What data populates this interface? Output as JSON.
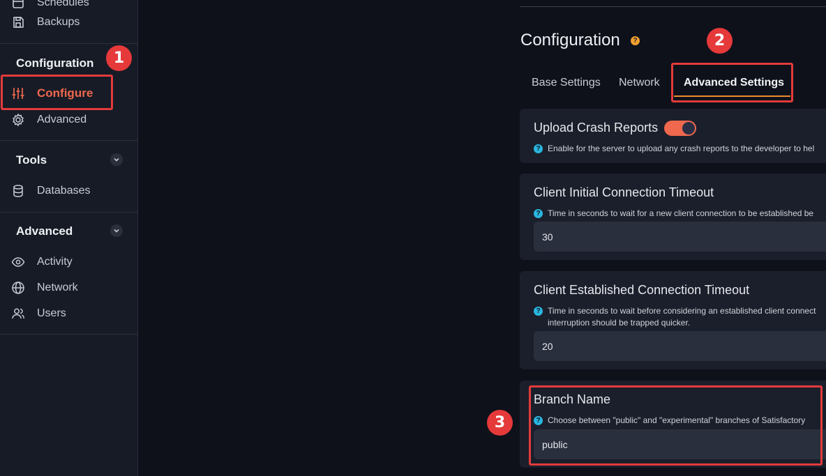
{
  "sidebar": {
    "top_partial_label": "Schedules",
    "backups_label": "Backups",
    "configuration_section": "Configuration",
    "configure_label": "Configure",
    "advanced_item_label": "Advanced",
    "tools_section": "Tools",
    "databases_label": "Databases",
    "advanced_section": "Advanced",
    "activity_label": "Activity",
    "network_label": "Network",
    "users_label": "Users"
  },
  "annotations": {
    "step1": "1",
    "step2": "2",
    "step3": "3"
  },
  "main": {
    "title": "Configuration",
    "help_glyph": "?",
    "tabs": [
      "Base Settings",
      "Network",
      "Advanced Settings"
    ],
    "cards": {
      "crash": {
        "title": "Upload Crash Reports",
        "help": "Enable for the server to upload any crash reports to the developer to hel",
        "enabled": true
      },
      "initial_timeout": {
        "title": "Client Initial Connection Timeout",
        "help": "Time in seconds to wait for a new client connection to be established be",
        "value": "30"
      },
      "established_timeout": {
        "title": "Client Established Connection Timeout",
        "help_line1": "Time in seconds to wait before considering an established client connect",
        "help_line2": "interruption should be trapped quicker.",
        "value": "20"
      },
      "branch": {
        "title": "Branch Name",
        "help": "Choose between \"public\" and \"experimental\" branches of Satisfactory",
        "value": "public"
      }
    }
  },
  "colors": {
    "accent": "#f0684d",
    "annotation": "#e5393a",
    "tab_underline": "#f08b2e"
  }
}
